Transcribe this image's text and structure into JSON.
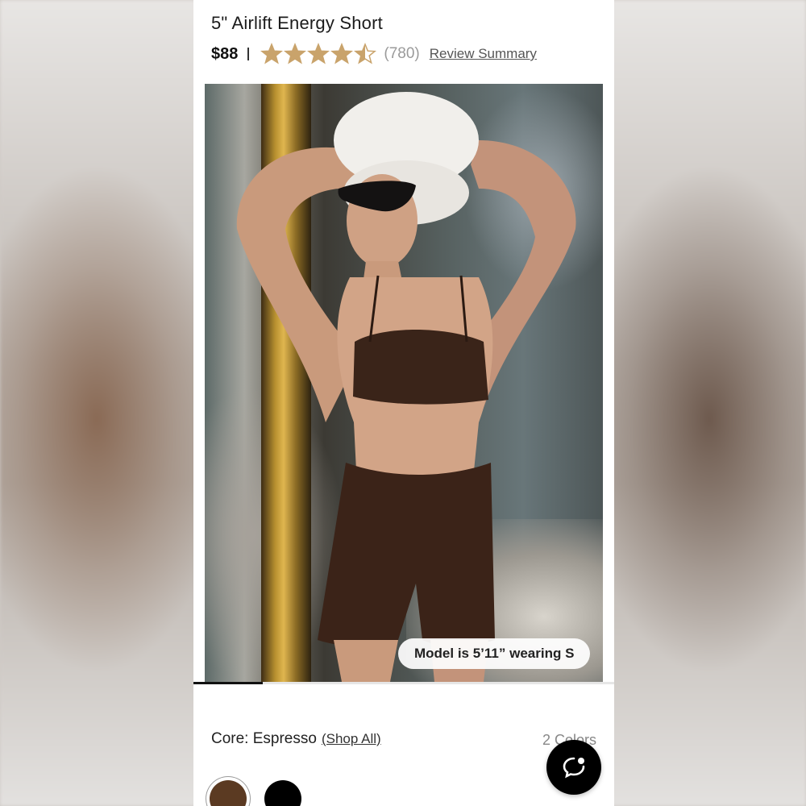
{
  "product": {
    "title": "5\" Airlift Energy Short",
    "price": "$88",
    "rating": 4.5,
    "rating_max": 5,
    "review_count": "(780)",
    "review_summary_label": "Review Summary"
  },
  "gallery": {
    "model_badge": "Model is 5’11” wearing S",
    "progress_fraction": 0.165
  },
  "color_selector": {
    "label": "Core: Espresso",
    "shop_all_label": "(Shop All)",
    "count_label": "2 Colors",
    "swatches": [
      {
        "name": "Espresso",
        "hex": "#5b3a22",
        "selected": true
      },
      {
        "name": "Black",
        "hex": "#000000",
        "selected": false
      }
    ]
  },
  "chat": {
    "icon": "chat-bubble-icon"
  },
  "colors": {
    "star_fill": "#c9a36b",
    "star_empty": "#d9cdb9",
    "text": "#1b1b1b"
  }
}
